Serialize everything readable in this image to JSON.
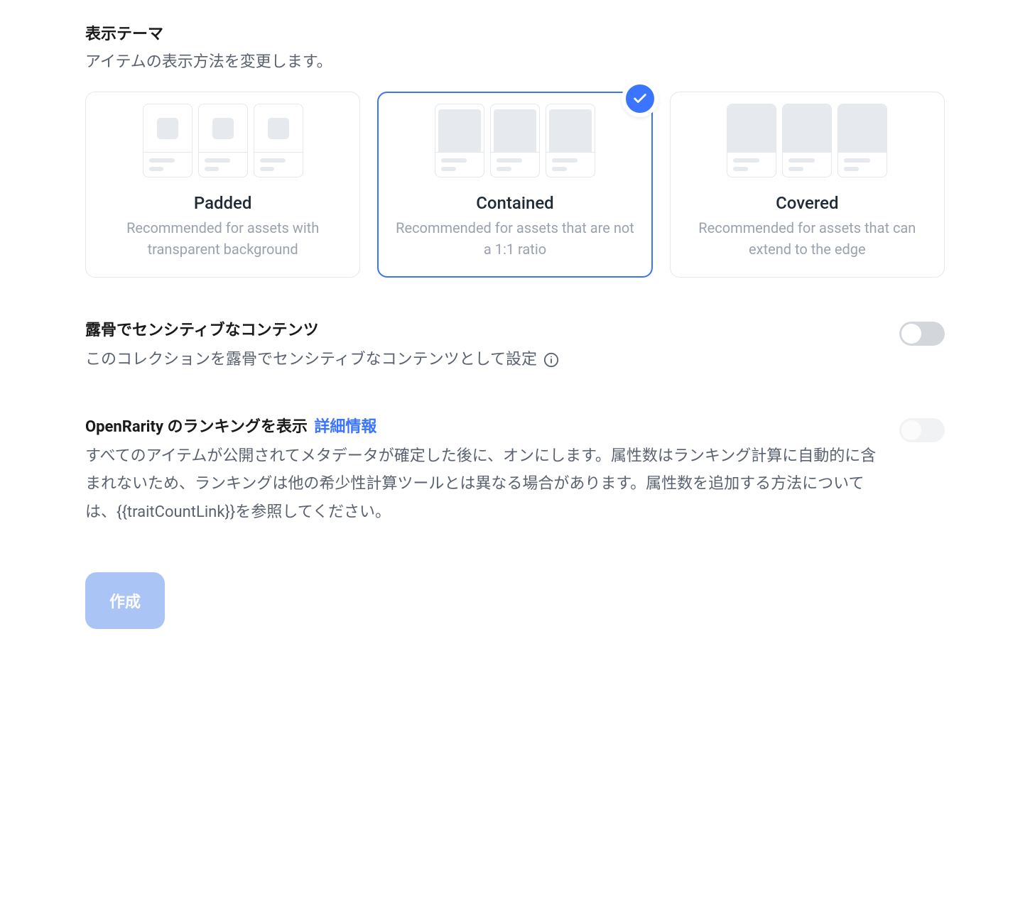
{
  "displayTheme": {
    "title": "表示テーマ",
    "description": "アイテムの表示方法を変更します。",
    "options": [
      {
        "name": "Padded",
        "desc": "Recommended for assets with transparent background",
        "selected": false
      },
      {
        "name": "Contained",
        "desc": "Recommended for assets that are not a 1:1 ratio",
        "selected": true
      },
      {
        "name": "Covered",
        "desc": "Recommended for assets that can extend to the edge",
        "selected": false
      }
    ]
  },
  "explicit": {
    "title": "露骨でセンシティブなコンテンツ",
    "desc": "このコレクションを露骨でセンシティブなコンテンツとして設定",
    "enabled": false
  },
  "openrarity": {
    "titlePrefix": "OpenRarity のランキングを表示",
    "moreLink": "詳細情報",
    "desc": "すべてのアイテムが公開されてメタデータが確定した後に、オンにします。属性数はランキング計算に自動的に含まれないため、ランキングは他の希少性計算ツールとは異なる場合があります。属性数を追加する方法については、{{traitCountLink}}を参照してください。",
    "enabled": false,
    "disabled": true
  },
  "createButton": "作成"
}
